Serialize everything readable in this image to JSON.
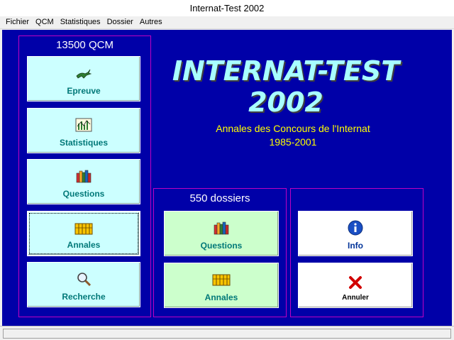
{
  "window": {
    "title": "Internat-Test 2002"
  },
  "menu": [
    "Fichier",
    "QCM",
    "Statistiques",
    "Dossier",
    "Autres"
  ],
  "qcm_group": {
    "title": "13500 QCM",
    "buttons": [
      "Epreuve",
      "Statistiques",
      "Questions",
      "Annales",
      "Recherche"
    ]
  },
  "heading": {
    "title_line1": "INTERNAT-TEST",
    "title_line2": "2002",
    "subtitle_line1": "Annales des Concours de l'Internat",
    "subtitle_line2": "1985-2001"
  },
  "dossiers_group": {
    "title": "550 dossiers",
    "buttons": [
      "Questions",
      "Annales"
    ]
  },
  "misc_group": {
    "buttons": [
      "Info",
      "Annuler"
    ]
  },
  "colors": {
    "background": "#0000a8",
    "group_border": "#c000c0",
    "title": "#a8ffff",
    "subtitle": "#ffff00",
    "qcm_button": "#ccffff",
    "dossier_button": "#ccffcc"
  }
}
